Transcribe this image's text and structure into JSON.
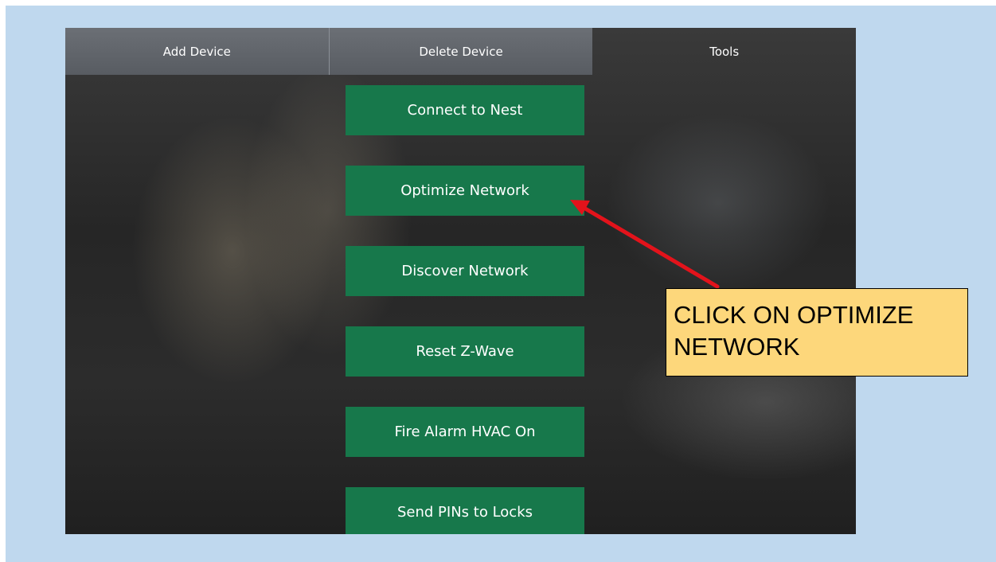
{
  "tabs": [
    {
      "label": "Add Device"
    },
    {
      "label": "Delete Device"
    },
    {
      "label": "Tools"
    }
  ],
  "tools": [
    {
      "label": "Connect to Nest"
    },
    {
      "label": "Optimize Network"
    },
    {
      "label": "Discover Network"
    },
    {
      "label": "Reset Z-Wave"
    },
    {
      "label": "Fire Alarm HVAC On"
    },
    {
      "label": "Send PINs to Locks"
    }
  ],
  "callout": {
    "line1": "CLICK ON OPTIMIZE",
    "line2": "NETWORK"
  },
  "colors": {
    "button": "#17784b",
    "callout_bg": "#fdd77b",
    "arrow": "#e3131b",
    "page_bg": "#bfd8ee"
  }
}
